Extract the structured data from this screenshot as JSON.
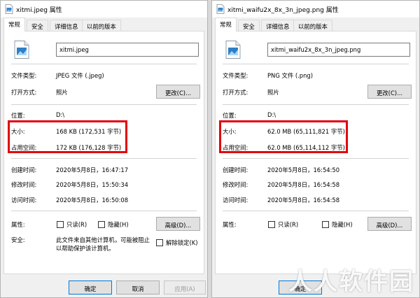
{
  "colors": {
    "highlight": "#e3000f",
    "accent": "#0078d7"
  },
  "left": {
    "title": "xitmi.jpeg 属性",
    "tabs": [
      "常规",
      "安全",
      "详细信息",
      "以前的版本"
    ],
    "filename": "xitmi.jpeg",
    "labels": {
      "type": "文件类型:",
      "open_with": "打开方式:",
      "location": "位置:",
      "size": "大小:",
      "size_on_disk": "占用空间:",
      "created": "创建时间:",
      "modified": "修改时间:",
      "accessed": "访问时间:",
      "attributes": "属性:",
      "security": "安全:"
    },
    "values": {
      "type": "JPEG 文件 (.jpeg)",
      "open_with": "照片",
      "location": "D:\\",
      "size": "168 KB (172,531 字节)",
      "size_on_disk": "172 KB (176,128 字节)",
      "created": "2020年5月8日，16:47:17",
      "modified": "2020年5月8日，15:50:34",
      "accessed": "2020年5月8日，16:50:08"
    },
    "change_button": "更改(C)...",
    "readonly_label": "只读(R)",
    "hidden_label": "隐藏(H)",
    "advanced_button": "高级(D)...",
    "security_text_1": "此文件来自其他计算机，可能被阻止",
    "security_text_2": "以帮助保护该计算机。",
    "unblock_label": "解除锁定(K)",
    "ok_button": "确定",
    "cancel_button": "取消",
    "apply_button": "应用(A)"
  },
  "right": {
    "title": "xitmi_waifu2x_8x_3n_jpeg.png 属性",
    "tabs": [
      "常规",
      "安全",
      "详细信息",
      "以前的版本"
    ],
    "filename": "xitmi_waifu2x_8x_3n_jpeg.png",
    "labels": {
      "type": "文件类型:",
      "open_with": "打开方式:",
      "location": "位置:",
      "size": "大小:",
      "size_on_disk": "占用空间:",
      "created": "创建时间:",
      "modified": "修改时间:",
      "accessed": "访问时间:",
      "attributes": "属性:"
    },
    "values": {
      "type": "PNG 文件 (.png)",
      "open_with": "照片",
      "location": "D:\\",
      "size": "62.0 MB (65,111,821 字节)",
      "size_on_disk": "62.0 MB (65,114,112 字节)",
      "created": "2020年5月8日，16:54:50",
      "modified": "2020年5月8日，16:54:58",
      "accessed": "2020年5月8日，16:54:58"
    },
    "change_button": "更改(C)...",
    "readonly_label": "只读(R)",
    "hidden_label": "隐藏(H)",
    "advanced_button": "高级(D)...",
    "ok_button": "确定"
  },
  "watermark": "人人软件园"
}
